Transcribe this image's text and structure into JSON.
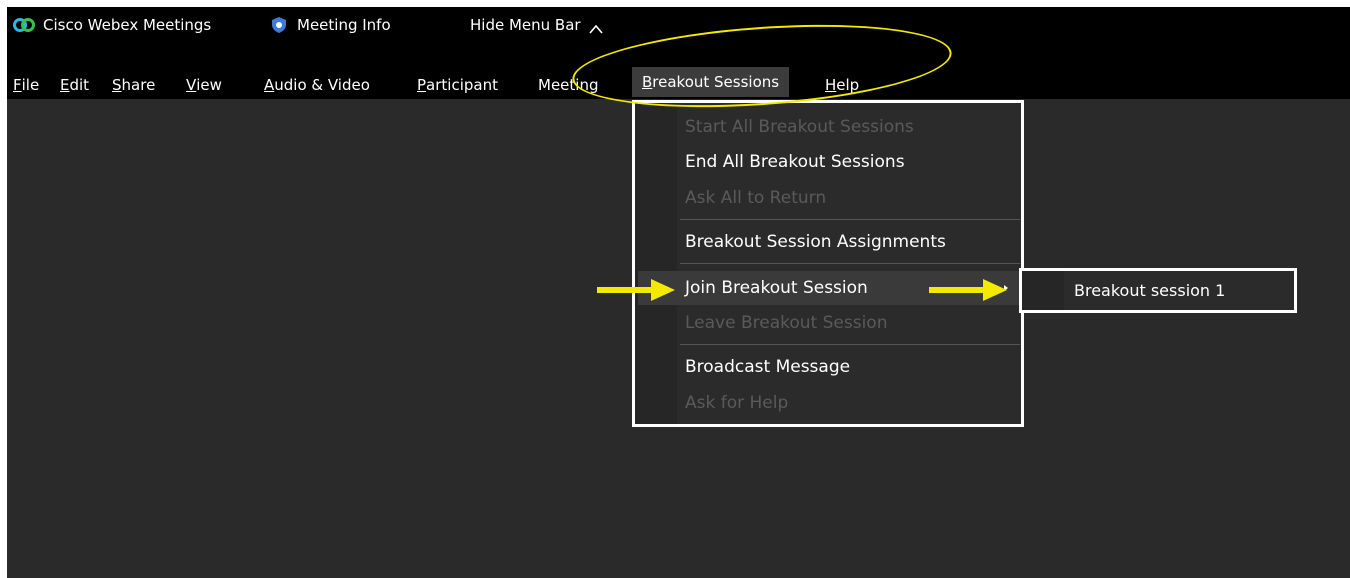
{
  "titlebar": {
    "app_name": "Cisco Webex Meetings",
    "meeting_info": "Meeting Info",
    "hide_menu_bar": "Hide Menu Bar",
    "chevron_glyph": "^"
  },
  "menubar": {
    "items": [
      {
        "first": "F",
        "rest": "ile"
      },
      {
        "first": "E",
        "rest": "dit"
      },
      {
        "first": "S",
        "rest": "hare"
      },
      {
        "first": "V",
        "rest": "iew"
      },
      {
        "first": "A",
        "rest": "udio & Video"
      },
      {
        "first": "P",
        "rest": "articipant"
      },
      {
        "first": "",
        "rest": "Meeting"
      },
      {
        "first": "B",
        "rest": "reakout Sessions"
      },
      {
        "first": "H",
        "rest": "elp"
      }
    ]
  },
  "dropdown": {
    "items": [
      {
        "label": "Start All Breakout Sessions",
        "disabled": true
      },
      {
        "label": "End All Breakout Sessions",
        "disabled": false
      },
      {
        "label": "Ask All to Return",
        "disabled": true
      },
      {
        "label": "Breakout Session Assignments",
        "disabled": false
      },
      {
        "label": "Join Breakout Session",
        "disabled": false
      },
      {
        "label": "Leave Breakout Session",
        "disabled": true
      },
      {
        "label": "Broadcast Message",
        "disabled": false
      },
      {
        "label": "Ask for Help",
        "disabled": true
      }
    ]
  },
  "submenu": {
    "items": [
      {
        "label": "Breakout session 1"
      }
    ]
  },
  "colors": {
    "annotation": "#f3ea00",
    "menubar_bg": "#000000",
    "content_bg": "#2a2a2a"
  }
}
